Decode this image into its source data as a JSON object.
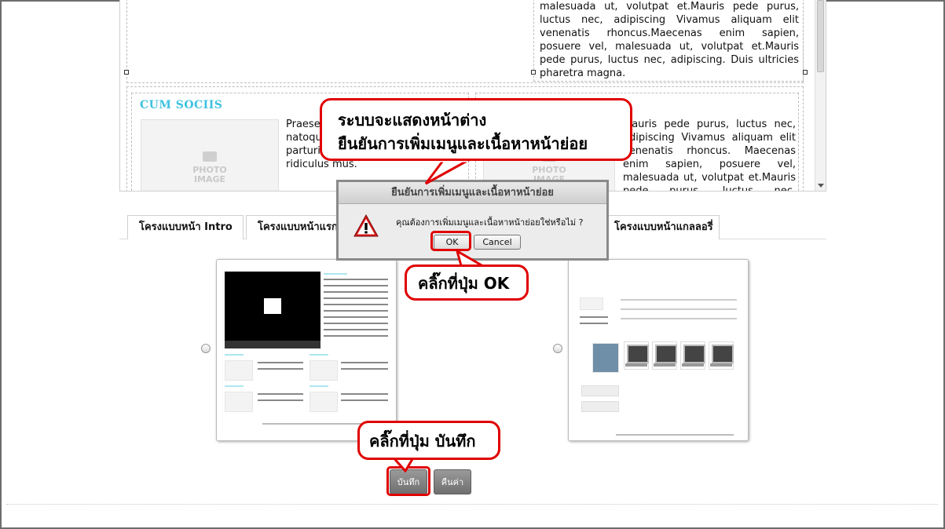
{
  "editor": {
    "top_right_text": "malesuada ut, volutpat et.Mauris pede purus, luctus nec, adipiscing Vivamus aliquam elit venenatis rhoncus.Maecenas enim sapien, posuere vel, malesuada ut, volutpat et.Mauris pede purus, luctus nec, adipiscing. Duis ultricies pharetra magna.",
    "section_heading": "CUM SOCIIS",
    "left_col_text": "Praese lacus. A mauris. suscipit natoque penatibus et magnis parturient montes nascetur ridiculus mus.",
    "right_col_text": "Mauris pede purus, luctus nec, adipiscing Vivamus aliquam elit venenatis rhoncus. Maecenas enim sapien, posuere vel, malesuada ut, volutpat et.Mauris pede purus, luctus nec, adipiscing.",
    "photo_placeholder": "PHOTO\nIMAGE"
  },
  "tabs": [
    {
      "label": "โครงแบบหน้า Intro"
    },
    {
      "label": "โครงแบบหน้าแรก"
    },
    {
      "label": "โครงแบบหน้าแกลลอรี่"
    }
  ],
  "dialog": {
    "title": "ยืนยันการเพิ่มเมนูและเนื้อหาหน้าย่อย",
    "message": "คุณต้องการเพิ่มเมนูและเนื้อหาหน้าย่อยใช่หรือไม่ ?",
    "ok_label": "OK",
    "cancel_label": "Cancel"
  },
  "callouts": {
    "dialog_note_line1": "ระบบจะแสดงหน้าต่าง",
    "dialog_note_line2": "ยืนยันการเพิ่มเมนูและเนื้อหาหน้าย่อย",
    "click_ok": "คลิ๊กที่ปุ่ม OK",
    "click_save": "คลิ๊กที่ปุ่ม บันทึก"
  },
  "buttons": {
    "save_label": "บันทึก",
    "reset_label": "คืนค่า"
  },
  "colors": {
    "callout_border": "#e00000",
    "heading_cyan": "#3fc2e0",
    "button_gray": "#808080"
  }
}
